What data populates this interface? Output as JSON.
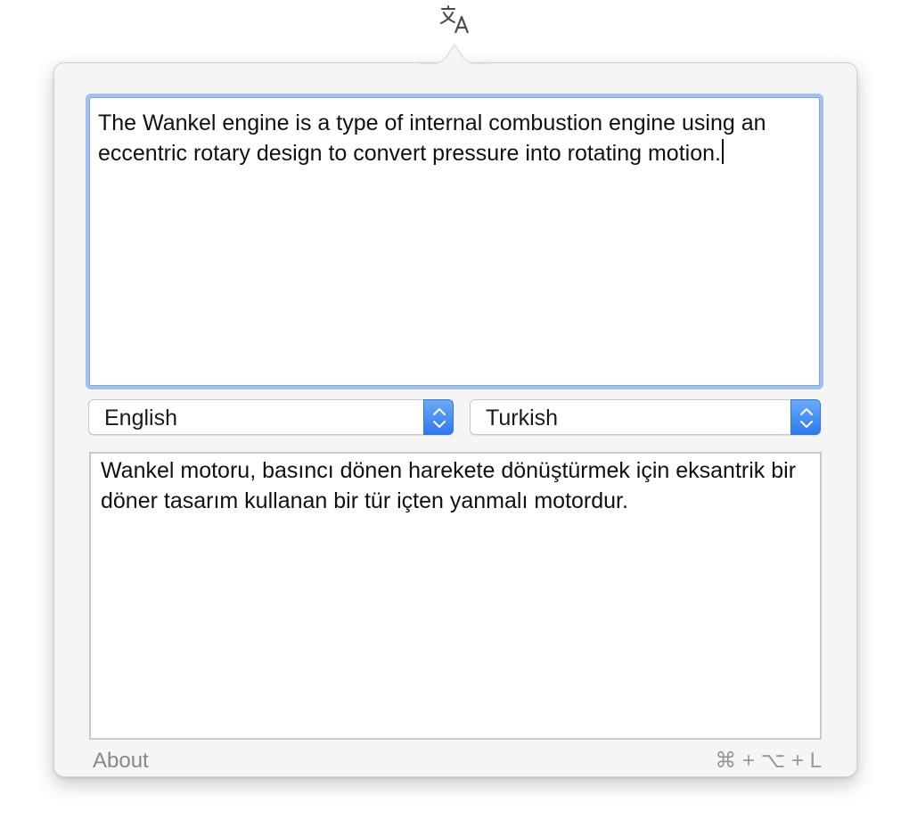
{
  "menubar": {
    "icon": "translate-icon"
  },
  "source": {
    "text": "The Wankel engine is a type of internal combustion engine using an eccentric rotary design to convert pressure into rotating motion."
  },
  "languages": {
    "from": "English",
    "to": "Turkish"
  },
  "translation": {
    "text": "Wankel motoru, basıncı dönen harekete dönüştürmek için eksantrik bir döner tasarım kullanan bir tür içten yanmalı motordur."
  },
  "footer": {
    "about_label": "About",
    "shortcut": "⌘ + ⌥ + L"
  },
  "colors": {
    "focus_ring": "#9fc2f0",
    "stepper": "#2c7af0"
  }
}
